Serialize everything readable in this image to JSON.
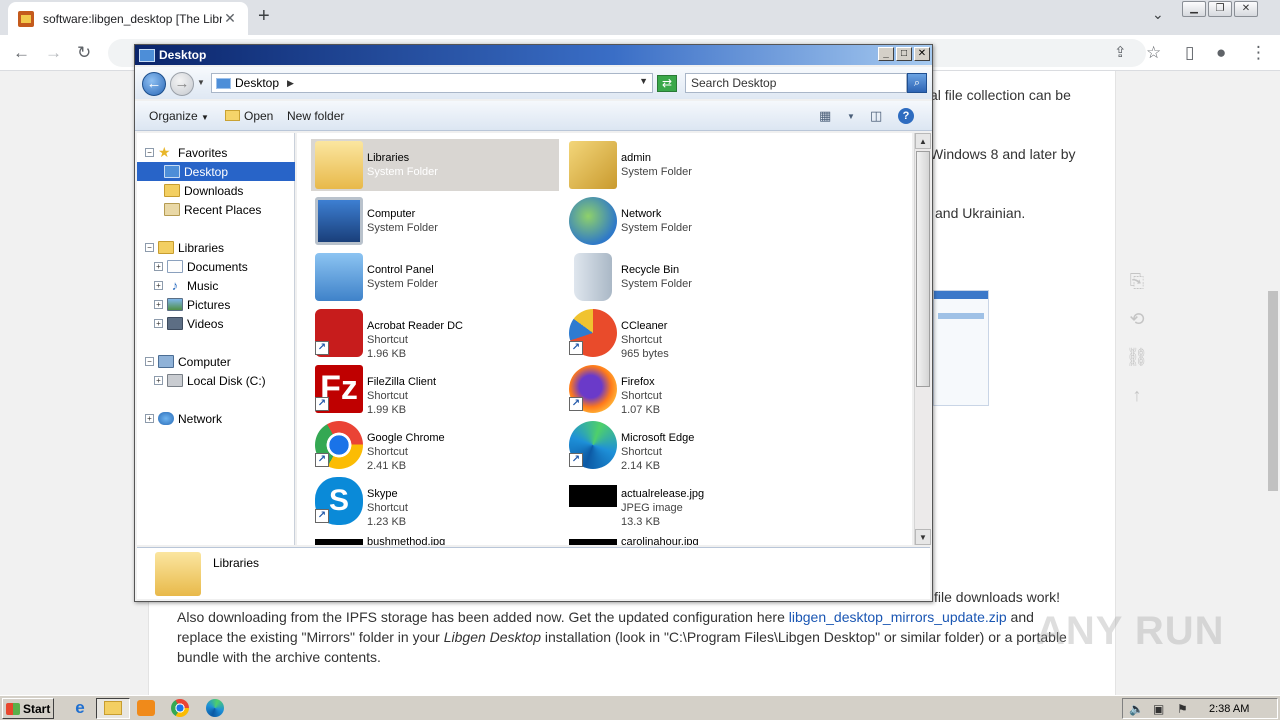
{
  "browser": {
    "tab_title": "software:libgen_desktop [The Librar",
    "tab_close": "✕",
    "new_tab": "+",
    "tab_menu": "⌄",
    "window_buttons": [
      "▁",
      "❐",
      "✕"
    ]
  },
  "page": {
    "lines": [
      "al file collection can be",
      "Windows 8 and later by",
      "and Ukrainian."
    ],
    "body_line1": "file downloads work!",
    "body_line2_a": "Also downloading from the IPFS storage has been added now. Get the updated configuration here ",
    "body_link": "libgen_desktop_mirrors_update.zip",
    "body_line2_b": " and",
    "body_line3_a": "replace the existing \"Mirrors\" folder in your ",
    "body_line3_em": "Libgen Desktop",
    "body_line3_b": " installation (look in \"C:\\Program Files\\Libgen Desktop\" or similar folder) or a portable",
    "body_line4": "bundle with the archive contents.",
    "watermark": "ANY RUN"
  },
  "explorer": {
    "title": "Desktop",
    "address": "Desktop",
    "search_placeholder": "Search Desktop",
    "commands": {
      "organize": "Organize",
      "open": "Open",
      "new_folder": "New folder"
    },
    "nav": {
      "favorites": "Favorites",
      "desktop": "Desktop",
      "downloads": "Downloads",
      "recent_places": "Recent Places",
      "libraries": "Libraries",
      "documents": "Documents",
      "music": "Music",
      "pictures": "Pictures",
      "videos": "Videos",
      "computer": "Computer",
      "local_disk": "Local Disk (C:)",
      "network": "Network"
    },
    "items": [
      {
        "name": "Libraries",
        "type": "System Folder",
        "size": ""
      },
      {
        "name": "admin",
        "type": "System Folder",
        "size": ""
      },
      {
        "name": "Computer",
        "type": "System Folder",
        "size": ""
      },
      {
        "name": "Network",
        "type": "System Folder",
        "size": ""
      },
      {
        "name": "Control Panel",
        "type": "System Folder",
        "size": ""
      },
      {
        "name": "Recycle Bin",
        "type": "System Folder",
        "size": ""
      },
      {
        "name": "Acrobat Reader DC",
        "type": "Shortcut",
        "size": "1.96 KB"
      },
      {
        "name": "CCleaner",
        "type": "Shortcut",
        "size": "965 bytes"
      },
      {
        "name": "FileZilla Client",
        "type": "Shortcut",
        "size": "1.99 KB"
      },
      {
        "name": "Firefox",
        "type": "Shortcut",
        "size": "1.07 KB"
      },
      {
        "name": "Google Chrome",
        "type": "Shortcut",
        "size": "2.41 KB"
      },
      {
        "name": "Microsoft Edge",
        "type": "Shortcut",
        "size": "2.14 KB"
      },
      {
        "name": "Skype",
        "type": "Shortcut",
        "size": "1.23 KB"
      },
      {
        "name": "actualrelease.jpg",
        "type": "JPEG image",
        "size": "13.3 KB"
      },
      {
        "name": "bushmethod.jpg",
        "type": "",
        "size": ""
      },
      {
        "name": "carolinahour.jpg",
        "type": "",
        "size": ""
      }
    ],
    "details_name": "Libraries"
  },
  "taskbar": {
    "start_label": "Start",
    "clock": "2:38 AM"
  },
  "colors": {
    "selection": "#2864c8",
    "titlebar": "#0a246a",
    "link": "#1a56b3"
  }
}
